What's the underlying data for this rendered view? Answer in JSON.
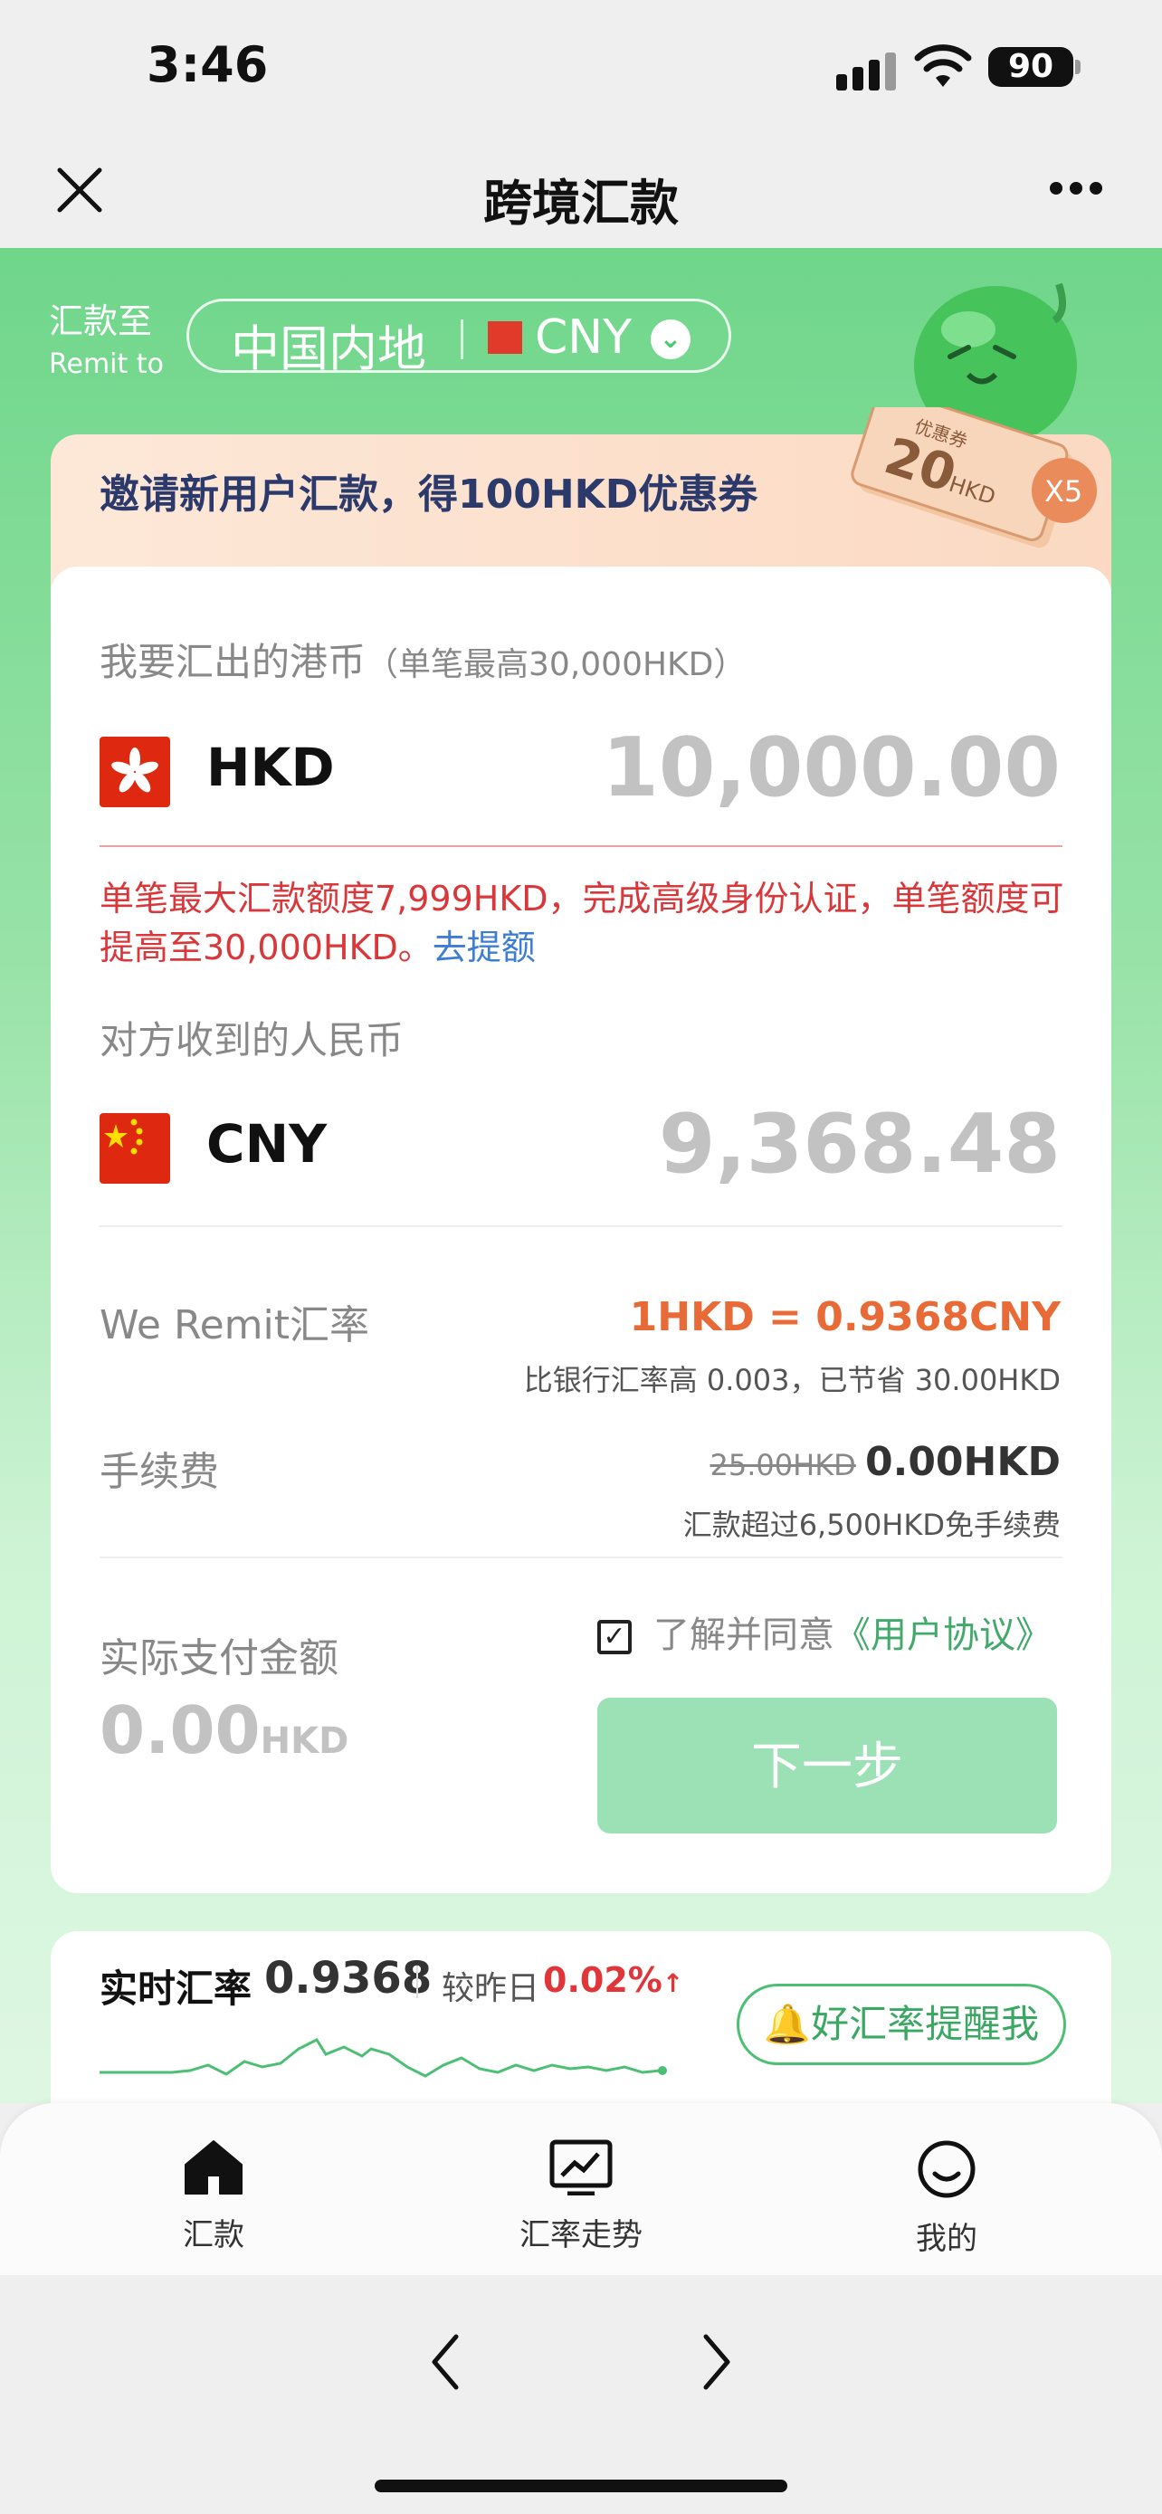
{
  "status_bar": {
    "time": "3:46",
    "battery": "90"
  },
  "nav": {
    "title": "跨境汇款"
  },
  "remit_to": {
    "label_zh": "汇款至",
    "label_en": "Remit to",
    "region": "中国内地",
    "currency": "CNY"
  },
  "promo": {
    "text": "邀请新用户汇款，得100HKD优惠券",
    "coupon_label": "优惠券",
    "coupon_value": "20",
    "coupon_unit": "HKD",
    "coupon_count": "X5"
  },
  "send": {
    "label": "我要汇出的港币",
    "limit": "（单笔最高30,000HKD）",
    "currency": "HKD",
    "placeholder": "10,000.00"
  },
  "warning": {
    "text": "单笔最大汇款额度7,999HKD，完成高级身份认证，单笔额度可提高至30,000HKD。",
    "link": "去提额"
  },
  "receive": {
    "label": "对方收到的人民币",
    "currency": "CNY",
    "amount": "9,368.48"
  },
  "rate": {
    "label": "We Remit汇率",
    "value": "1HKD = 0.9368CNY",
    "note": "比银行汇率高 0.003，已节省 30.00HKD"
  },
  "fee": {
    "label": "手续费",
    "old": "25.00HKD",
    "new": "0.00HKD",
    "note": "汇款超过6,500HKD免手续费"
  },
  "payment": {
    "label": "实际支付金额",
    "amount": "0.00",
    "unit": "HKD",
    "agree_text": "了解并同意",
    "agreement_link": "《用户协议》",
    "agree_checked": true,
    "next_button": "下一步"
  },
  "live_rate": {
    "title": "实时汇率",
    "value": "0.9368",
    "compare_label": "较昨日",
    "change": "0.02%",
    "alert_button": "好汇率提醒我"
  },
  "tabs": [
    {
      "label": "汇款",
      "icon": "home-icon"
    },
    {
      "label": "汇率走势",
      "icon": "chart-trend-icon"
    },
    {
      "label": "我的",
      "icon": "profile-icon"
    }
  ],
  "colors": {
    "brand_green": "#4cc86d",
    "warning_red": "#d9373a",
    "rate_orange": "#e86a37",
    "link_blue": "#3d7dd3"
  }
}
